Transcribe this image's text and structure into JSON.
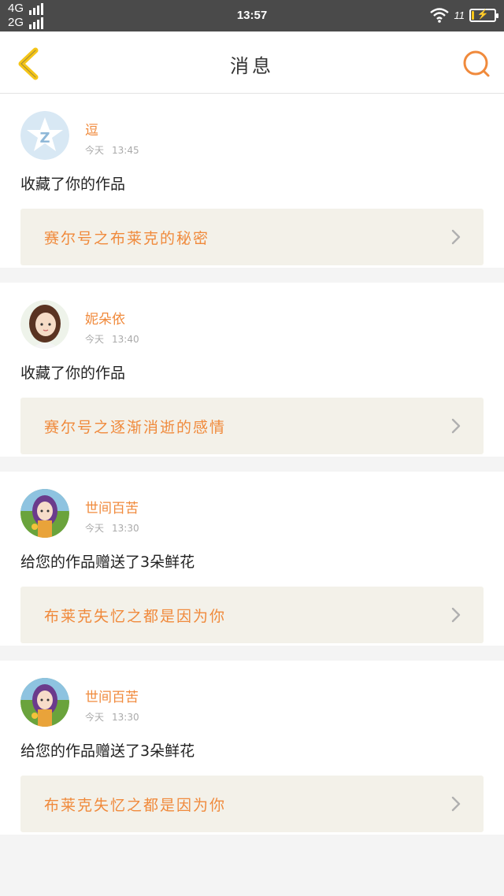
{
  "status": {
    "net_top": "4G",
    "net_bottom": "2G",
    "time": "13:57",
    "battery_text": "11",
    "battery_level": 0.11
  },
  "header": {
    "title": "消息",
    "back_icon": "chevron-left-icon",
    "search_icon": "search-icon"
  },
  "colors": {
    "accent": "#f08a3c",
    "work_bg": "#f3f1e9",
    "back_icon": "#f5c518"
  },
  "messages": [
    {
      "user": "逗",
      "day": "今天",
      "time": "13:45",
      "action": "收藏了你的作品",
      "work": "赛尔号之布莱克的秘密",
      "avatar": "default-qq-avatar"
    },
    {
      "user": "妮朵依",
      "day": "今天",
      "time": "13:40",
      "action": "收藏了你的作品",
      "work": "赛尔号之逐渐消逝的感情",
      "avatar": "girl-portrait-avatar"
    },
    {
      "user": "世间百苦",
      "day": "今天",
      "time": "13:30",
      "action": "给您的作品赠送了3朵鲜花",
      "work": "布莱克失忆之都是因为你",
      "avatar": "anime-girl-avatar"
    },
    {
      "user": "世间百苦",
      "day": "今天",
      "time": "13:30",
      "action": "给您的作品赠送了3朵鲜花",
      "work": "布莱克失忆之都是因为你",
      "avatar": "anime-girl-avatar"
    }
  ]
}
